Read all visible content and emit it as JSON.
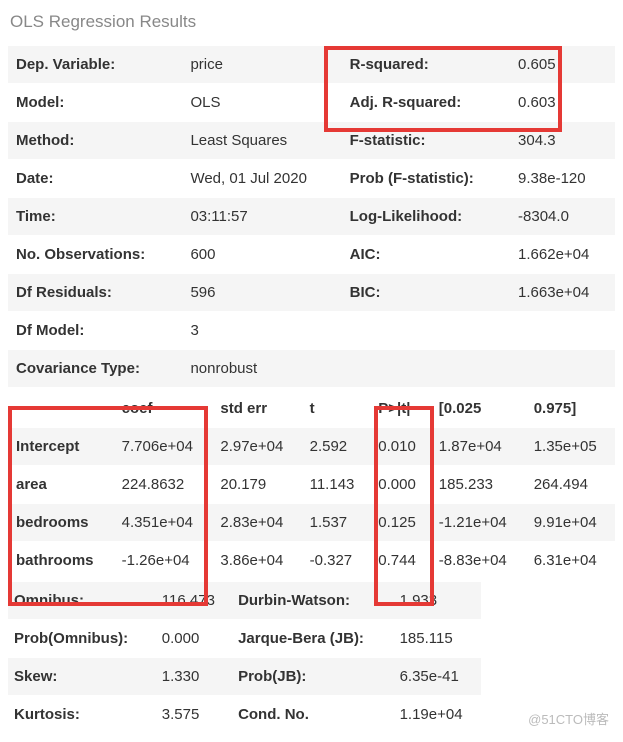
{
  "title": "OLS Regression Results",
  "top": {
    "left_labels": [
      "Dep. Variable:",
      "Model:",
      "Method:",
      "Date:",
      "Time:",
      "No. Observations:",
      "Df Residuals:",
      "Df Model:",
      "Covariance Type:"
    ],
    "left_values": [
      "price",
      "OLS",
      "Least Squares",
      "Wed, 01 Jul 2020",
      "03:11:57",
      "600",
      "596",
      "3",
      "nonrobust"
    ],
    "right_labels": [
      "R-squared:",
      "Adj. R-squared:",
      "F-statistic:",
      "Prob (F-statistic):",
      "Log-Likelihood:",
      "AIC:",
      "BIC:"
    ],
    "right_values": [
      "0.605",
      "0.603",
      "304.3",
      "9.38e-120",
      "-8304.0",
      "1.662e+04",
      "1.663e+04"
    ]
  },
  "coef": {
    "headers": [
      "",
      "coef",
      "std err",
      "t",
      "P>|t|",
      "[0.025",
      "0.975]"
    ],
    "rows": [
      {
        "name": "Intercept",
        "coef": "7.706e+04",
        "stderr": "2.97e+04",
        "t": "2.592",
        "p": "0.010",
        "lo": "1.87e+04",
        "hi": "1.35e+05"
      },
      {
        "name": "area",
        "coef": "224.8632",
        "stderr": "20.179",
        "t": "11.143",
        "p": "0.000",
        "lo": "185.233",
        "hi": "264.494"
      },
      {
        "name": "bedrooms",
        "coef": "4.351e+04",
        "stderr": "2.83e+04",
        "t": "1.537",
        "p": "0.125",
        "lo": "-1.21e+04",
        "hi": "9.91e+04"
      },
      {
        "name": "bathrooms",
        "coef": "-1.26e+04",
        "stderr": "3.86e+04",
        "t": "-0.327",
        "p": "0.744",
        "lo": "-8.83e+04",
        "hi": "6.31e+04"
      }
    ]
  },
  "diag": {
    "left_labels": [
      "Omnibus:",
      "Prob(Omnibus):",
      "Skew:",
      "Kurtosis:"
    ],
    "left_values": [
      "116.473",
      "0.000",
      "1.330",
      "3.575"
    ],
    "right_labels": [
      "Durbin-Watson:",
      "Jarque-Bera (JB):",
      "Prob(JB):",
      "Cond. No."
    ],
    "right_values": [
      "1.933",
      "185.115",
      "6.35e-41",
      "1.19e+04"
    ]
  },
  "watermark": "@51CTO博客"
}
